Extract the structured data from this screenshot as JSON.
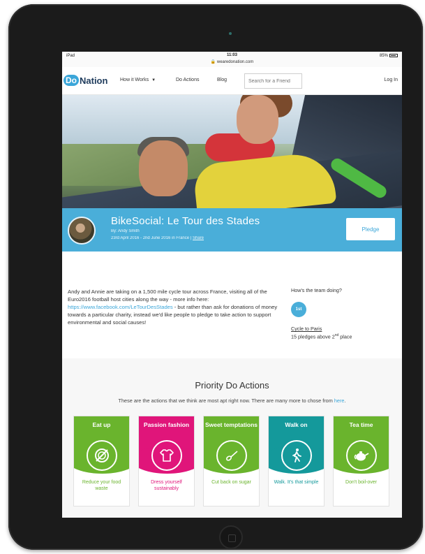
{
  "status_bar": {
    "device": "iPad",
    "time": "11:03",
    "url": "wearedonation.com",
    "battery": "85%"
  },
  "nav": {
    "logo_do": "Do",
    "logo_rest": "Nation",
    "how_it_works": "How it Works",
    "do_actions": "Do Actions",
    "blog": "Blog",
    "search_placeholder": "Search for a Friend",
    "login": "Log In"
  },
  "campaign": {
    "title": "BikeSocial: Le Tour des Stades",
    "by": "By: Andy Smith",
    "dates": "23rd April 2016 - 2nd June 2016 in France",
    "separator": "|",
    "share": "Share",
    "pledge_button": "Pledge",
    "description_before": "Andy and Annie are taking on a 1,500 mile cycle tour across France, visiting all of the Euro2016 football host cities along the way - more info here: ",
    "description_link": "https://www.facebook.com/LeTourDesStades",
    "description_after": " - but rather than ask for donations of money towards a particular charity, instead we'd like people to pledge to take action to support environmental and social causes!"
  },
  "team": {
    "heading": "How's the team doing?",
    "badge": "1st",
    "team_name": "Cycle to Paris",
    "pledges_text": "15 pledges above 2",
    "pledges_sup": "nd",
    "pledges_suffix": " place"
  },
  "priority": {
    "heading": "Priority Do Actions",
    "subtitle": "These are the actions that we think are most apt right now. There are many more to chose from ",
    "subtitle_link": "here",
    "subtitle_end": ".",
    "cards": [
      {
        "title": "Eat up",
        "footer": "Reduce your food waste",
        "color": "#6ab42d",
        "icon": "plate-icon"
      },
      {
        "title": "Passion fashion",
        "footer": "Dress yourself sustainably",
        "color": "#e0157a",
        "icon": "shirt-icon"
      },
      {
        "title": "Sweet temptations",
        "footer": "Cut back on sugar",
        "color": "#6ab42d",
        "icon": "spoon-icon"
      },
      {
        "title": "Walk on",
        "footer": "Walk. It's that simple",
        "color": "#14999b",
        "icon": "walking-person-icon"
      },
      {
        "title": "Tea time",
        "footer": "Don't boil-over",
        "color": "#6ab42d",
        "icon": "teapot-icon"
      }
    ]
  }
}
